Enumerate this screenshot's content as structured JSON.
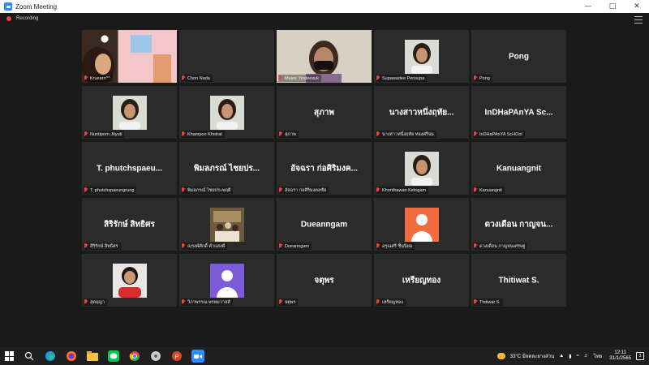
{
  "window": {
    "title": "Zoom Meeting"
  },
  "recording": {
    "label": "Recording"
  },
  "tiles": [
    {
      "label": "Kruearn^^",
      "display": "",
      "kind": "video-kitchen"
    },
    {
      "label": "Chon Nada",
      "display": "",
      "kind": "blank"
    },
    {
      "label": "Malee Yindeesuk",
      "display": "",
      "kind": "video-mask"
    },
    {
      "label": "Supawadee Pensupa",
      "display": "",
      "kind": "photo"
    },
    {
      "label": "Pong",
      "display": "Pong",
      "kind": "name"
    },
    {
      "label": "Nuntiporn Jityuti",
      "display": "",
      "kind": "photo"
    },
    {
      "label": "Khampoo Khotrat",
      "display": "",
      "kind": "photo"
    },
    {
      "label": "สุภาพ",
      "display": "สุภาพ",
      "kind": "name"
    },
    {
      "label": "นางสาวหนึ่งฤทัย ทองศรีจม",
      "display": "นางสาวหนึ่งฤทัย...",
      "kind": "name"
    },
    {
      "label": "InDHaPAnYA ScHOol",
      "display": "InDHaPAnYA Sc...",
      "kind": "name"
    },
    {
      "label": "T. phutchspaeungrung",
      "display": "T. phutchspaeu...",
      "kind": "name"
    },
    {
      "label": "พิมลภรณ์ ไชยประพฤติ",
      "display": "พิมลภรณ์ ไชยปร...",
      "kind": "name"
    },
    {
      "label": "อัจฉรา ก่อศิริมงคลชัย",
      "display": "อัจฉรา ก่อศิริมงค...",
      "kind": "name"
    },
    {
      "label": "Khonthawan Ketngam",
      "display": "",
      "kind": "photo"
    },
    {
      "label": "Kanuangnit",
      "display": "Kanuangnit",
      "kind": "name"
    },
    {
      "label": "สิริรักษ์ สิทธิศร",
      "display": "สิริรักษ์ สิทธิศร",
      "kind": "name"
    },
    {
      "label": "ณรงค์ศักดิ์ คำแสงดี",
      "display": "",
      "kind": "photo-group"
    },
    {
      "label": "Dueanngam",
      "display": "Dueanngam",
      "kind": "name"
    },
    {
      "label": "อรุณศรี ชื่นนิยม",
      "display": "",
      "kind": "avatar-orange"
    },
    {
      "label": "ดวงเดือน กาญจนเศรษฐ",
      "display": "ดวงเดือน กาญจน...",
      "kind": "name"
    },
    {
      "label": "สุดฤญา",
      "display": "",
      "kind": "photo-red"
    },
    {
      "label": "วิภาพรรณ พรหมวาสส์",
      "display": "",
      "kind": "avatar-purple"
    },
    {
      "label": "จตุพร",
      "display": "จตุพร",
      "kind": "name"
    },
    {
      "label": "เหรียญทอง",
      "display": "เหรียญทอง",
      "kind": "name"
    },
    {
      "label": "Thitiwat S.",
      "display": "Thitiwat S.",
      "kind": "name"
    }
  ],
  "taskbar": {
    "weather": "33°C มีลดละยางส่วน",
    "language": "ไทย",
    "time": "12:11",
    "date": "31/1/2565",
    "notifications": "3"
  },
  "colors": {
    "avatar_orange": "#f26d3d",
    "avatar_purple": "#7b5bd6",
    "recording_dot": "#e8463c",
    "zoom_blue": "#2d8cff"
  }
}
